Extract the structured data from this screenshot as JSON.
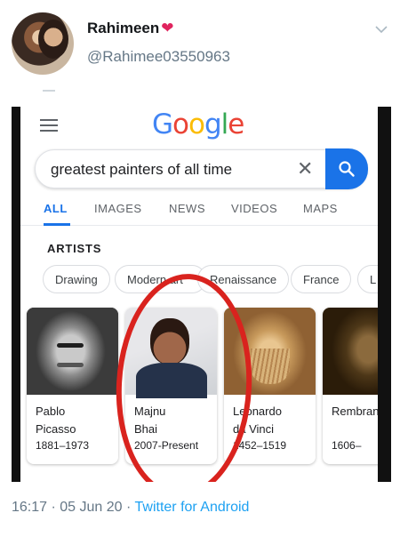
{
  "tweet": {
    "user_name": "Rahimeen",
    "heart": "❤",
    "handle": "@Rahimee03550963",
    "time": "16:17",
    "separator": "·",
    "date": "05 Jun 20",
    "source": "Twitter for Android"
  },
  "screenshot": {
    "logo": {
      "G": "G",
      "o1": "o",
      "o2": "o",
      "g": "g",
      "l": "l",
      "e": "e"
    },
    "search": {
      "query": "greatest painters of all time",
      "clear": "✕"
    },
    "tabs": [
      "ALL",
      "IMAGES",
      "NEWS",
      "VIDEOS",
      "MAPS"
    ],
    "active_tab": "ALL",
    "section_title": "ARTISTS",
    "chips": [
      "Drawing",
      "Modern art",
      "Renaissance",
      "France",
      "L"
    ],
    "artists": [
      {
        "name": "Pablo\nPicasso",
        "years": "1881–1973"
      },
      {
        "name": "Majnu\nBhai",
        "years": "2007-Present"
      },
      {
        "name": "Leonardo\nda Vinci",
        "years": "1452–1519"
      },
      {
        "name": "Rembrandt",
        "years": "1606–"
      }
    ],
    "colors": {
      "accent": "#1a73e8",
      "annotation": "#d9231e"
    }
  }
}
